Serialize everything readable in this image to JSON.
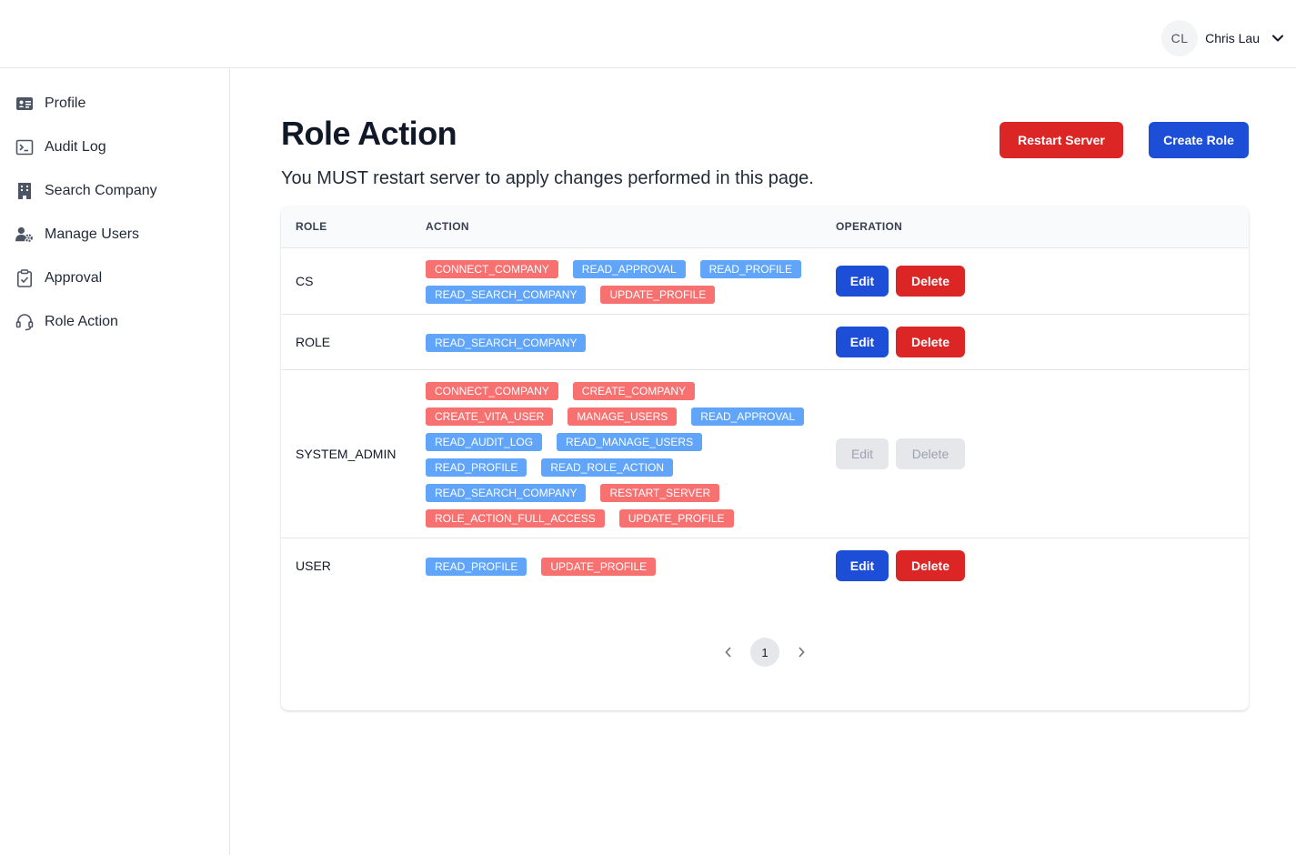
{
  "header": {
    "user": {
      "initials": "CL",
      "name": "Chris Lau"
    }
  },
  "sidebar": {
    "items": [
      {
        "label": "Profile",
        "icon": "id-card-icon"
      },
      {
        "label": "Audit Log",
        "icon": "terminal-icon"
      },
      {
        "label": "Search Company",
        "icon": "building-icon"
      },
      {
        "label": "Manage Users",
        "icon": "user-gear-icon"
      },
      {
        "label": "Approval",
        "icon": "clipboard-check-icon"
      },
      {
        "label": "Role Action",
        "icon": "headset-icon"
      }
    ]
  },
  "page": {
    "title": "Role Action",
    "subtitle": "You MUST restart server to apply changes performed in this page.",
    "restart_label": "Restart Server",
    "create_label": "Create Role"
  },
  "table": {
    "columns": [
      "ROLE",
      "ACTION",
      "OPERATION"
    ],
    "edit_label": "Edit",
    "delete_label": "Delete",
    "rows": [
      {
        "role": "CS",
        "disabled": false,
        "actions": [
          {
            "name": "CONNECT_COMPANY",
            "color": "red"
          },
          {
            "name": "READ_APPROVAL",
            "color": "blue"
          },
          {
            "name": "READ_PROFILE",
            "color": "blue"
          },
          {
            "name": "READ_SEARCH_COMPANY",
            "color": "blue"
          },
          {
            "name": "UPDATE_PROFILE",
            "color": "red"
          }
        ]
      },
      {
        "role": "ROLE",
        "disabled": false,
        "actions": [
          {
            "name": "READ_SEARCH_COMPANY",
            "color": "blue"
          }
        ]
      },
      {
        "role": "SYSTEM_ADMIN",
        "disabled": true,
        "actions": [
          {
            "name": "CONNECT_COMPANY",
            "color": "red"
          },
          {
            "name": "CREATE_COMPANY",
            "color": "red"
          },
          {
            "name": "CREATE_VITA_USER",
            "color": "red"
          },
          {
            "name": "MANAGE_USERS",
            "color": "red"
          },
          {
            "name": "READ_APPROVAL",
            "color": "blue"
          },
          {
            "name": "READ_AUDIT_LOG",
            "color": "blue"
          },
          {
            "name": "READ_MANAGE_USERS",
            "color": "blue"
          },
          {
            "name": "READ_PROFILE",
            "color": "blue"
          },
          {
            "name": "READ_ROLE_ACTION",
            "color": "blue"
          },
          {
            "name": "READ_SEARCH_COMPANY",
            "color": "blue"
          },
          {
            "name": "RESTART_SERVER",
            "color": "red"
          },
          {
            "name": "ROLE_ACTION_FULL_ACCESS",
            "color": "red"
          },
          {
            "name": "UPDATE_PROFILE",
            "color": "red"
          }
        ]
      },
      {
        "role": "USER",
        "disabled": false,
        "actions": [
          {
            "name": "READ_PROFILE",
            "color": "blue"
          },
          {
            "name": "UPDATE_PROFILE",
            "color": "red"
          }
        ]
      }
    ]
  },
  "pagination": {
    "current_page": "1"
  },
  "colors": {
    "primary": "#1d4ed8",
    "danger": "#dc2626",
    "tag_red": "#f87171",
    "tag_blue": "#60a5fa"
  }
}
